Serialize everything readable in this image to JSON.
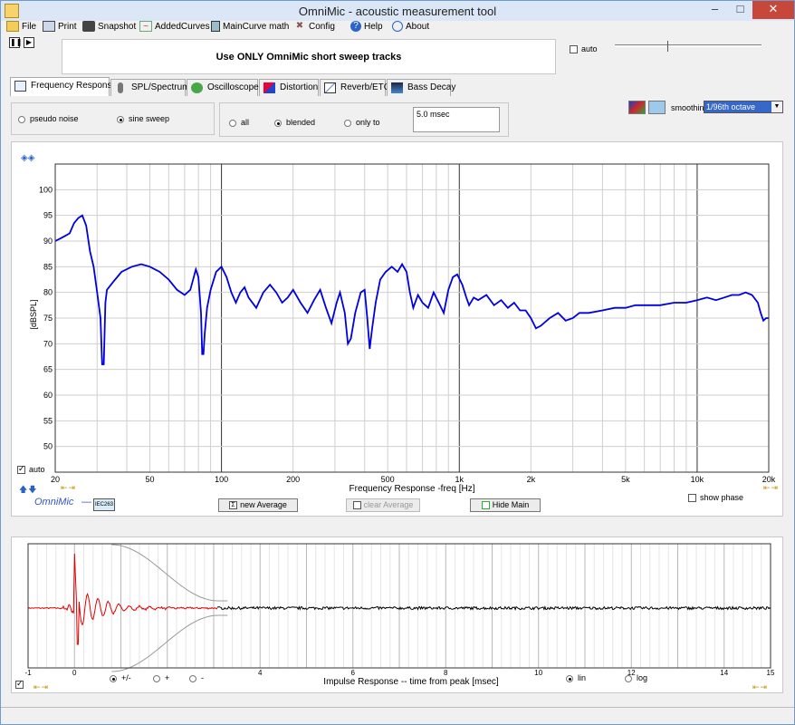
{
  "window": {
    "title": "OmniMic - acoustic measurement tool"
  },
  "menu": [
    {
      "label": "File",
      "icon": "folder-icon"
    },
    {
      "label": "Print",
      "icon": "printer-icon"
    },
    {
      "label": "Snapshot",
      "icon": "camera-icon"
    },
    {
      "label": "AddedCurves",
      "icon": "curves-icon"
    },
    {
      "label": "MainCurve math",
      "icon": "calculator-icon"
    },
    {
      "label": "Config",
      "icon": "tools-icon"
    },
    {
      "label": "Help",
      "icon": "help-icon"
    },
    {
      "label": "About",
      "icon": "chat-icon"
    }
  ],
  "banner": "Use ONLY OmniMic short sweep tracks",
  "top_auto_label": "auto",
  "tabs": [
    {
      "label": "Frequency Response",
      "active": true
    },
    {
      "label": "SPL/Spectrum"
    },
    {
      "label": "Oscilloscope"
    },
    {
      "label": "Distortion"
    },
    {
      "label": "Reverb/ETC"
    },
    {
      "label": "Bass Decay"
    }
  ],
  "mode": {
    "pseudo_noise": "pseudo noise",
    "sine_sweep": "sine sweep",
    "selected": "sine sweep"
  },
  "sync": {
    "all": "all",
    "blended": "blended",
    "only_to": "only to",
    "selected": "blended",
    "time_value": "5.0 msec"
  },
  "smoothing": {
    "label": "smoothing",
    "value": "1/96th octave"
  },
  "freq_controls": {
    "auto_label": "auto",
    "auto_checked": true,
    "brand": "OmniMic",
    "mic_badge": "IEC263",
    "new_average": "new Average",
    "clear_average": "clear Average",
    "hide_main": "Hide Main",
    "show_phase": "show phase"
  },
  "impulse_controls": {
    "pm": "+/-",
    "plus": "+",
    "minus": "-",
    "lin": "lin",
    "log": "log",
    "selected_polarity": "+/-",
    "selected_scale": "lin"
  },
  "chart_data": [
    {
      "type": "line",
      "xlabel": "Frequency Response -freq [Hz]",
      "ylabel": "[dBSPL]",
      "x_scale": "log",
      "xlim": [
        20,
        20000
      ],
      "ylim": [
        45,
        105
      ],
      "xticks": [
        {
          "value": 20,
          "label": "20"
        },
        {
          "value": 50,
          "label": "50"
        },
        {
          "value": 100,
          "label": "100"
        },
        {
          "value": 200,
          "label": "200"
        },
        {
          "value": 500,
          "label": "500"
        },
        {
          "value": 1000,
          "label": "1k"
        },
        {
          "value": 2000,
          "label": "2k"
        },
        {
          "value": 5000,
          "label": "5k"
        },
        {
          "value": 10000,
          "label": "10k"
        },
        {
          "value": 20000,
          "label": "20k"
        }
      ],
      "yticks": [
        50,
        55,
        60,
        65,
        70,
        75,
        80,
        85,
        90,
        95,
        100
      ],
      "grid": true,
      "series": [
        {
          "color": "#0000e0",
          "points": [
            [
              20,
              90
            ],
            [
              21,
              90.5
            ],
            [
              22,
              91
            ],
            [
              23,
              91.5
            ],
            [
              24,
              93.5
            ],
            [
              25,
              94.5
            ],
            [
              26,
              95
            ],
            [
              27,
              93
            ],
            [
              28,
              88
            ],
            [
              29,
              85
            ],
            [
              30,
              80
            ],
            [
              31,
              75
            ],
            [
              31.5,
              66
            ],
            [
              32,
              66
            ],
            [
              32.5,
              78
            ],
            [
              33,
              80.5
            ],
            [
              35,
              82
            ],
            [
              38,
              84
            ],
            [
              42,
              85
            ],
            [
              46,
              85.5
            ],
            [
              50,
              85
            ],
            [
              55,
              84
            ],
            [
              60,
              82.5
            ],
            [
              65,
              80.5
            ],
            [
              70,
              79.5
            ],
            [
              74,
              80.5
            ],
            [
              78,
              84.5
            ],
            [
              80,
              83
            ],
            [
              82,
              76
            ],
            [
              83,
              68
            ],
            [
              84,
              68
            ],
            [
              85,
              72
            ],
            [
              87,
              77
            ],
            [
              90,
              80.5
            ],
            [
              95,
              84
            ],
            [
              100,
              85
            ],
            [
              105,
              83
            ],
            [
              110,
              80
            ],
            [
              115,
              78
            ],
            [
              120,
              80
            ],
            [
              125,
              81
            ],
            [
              130,
              79
            ],
            [
              140,
              77
            ],
            [
              150,
              80
            ],
            [
              160,
              81.5
            ],
            [
              170,
              80
            ],
            [
              180,
              78
            ],
            [
              190,
              79
            ],
            [
              200,
              80.5
            ],
            [
              215,
              78
            ],
            [
              230,
              76
            ],
            [
              245,
              78.5
            ],
            [
              260,
              80.5
            ],
            [
              275,
              77
            ],
            [
              290,
              74
            ],
            [
              305,
              78
            ],
            [
              315,
              80
            ],
            [
              330,
              76
            ],
            [
              340,
              70
            ],
            [
              350,
              71
            ],
            [
              365,
              76
            ],
            [
              385,
              80
            ],
            [
              400,
              80.5
            ],
            [
              410,
              75
            ],
            [
              420,
              69
            ],
            [
              430,
              73
            ],
            [
              445,
              78
            ],
            [
              465,
              82.5
            ],
            [
              490,
              84
            ],
            [
              520,
              85
            ],
            [
              550,
              84
            ],
            [
              575,
              85.5
            ],
            [
              600,
              84
            ],
            [
              620,
              80
            ],
            [
              640,
              77
            ],
            [
              670,
              79.5
            ],
            [
              700,
              78
            ],
            [
              740,
              77
            ],
            [
              780,
              80
            ],
            [
              820,
              78
            ],
            [
              860,
              76
            ],
            [
              900,
              80.5
            ],
            [
              940,
              83
            ],
            [
              980,
              83.5
            ],
            [
              1030,
              81.5
            ],
            [
              1070,
              79
            ],
            [
              1100,
              77.5
            ],
            [
              1150,
              79
            ],
            [
              1200,
              78.5
            ],
            [
              1300,
              79.5
            ],
            [
              1400,
              77.5
            ],
            [
              1500,
              78.5
            ],
            [
              1600,
              77
            ],
            [
              1700,
              78
            ],
            [
              1800,
              76.5
            ],
            [
              1900,
              76.5
            ],
            [
              2000,
              75
            ],
            [
              2100,
              73
            ],
            [
              2200,
              73.5
            ],
            [
              2400,
              75
            ],
            [
              2600,
              76
            ],
            [
              2800,
              74.5
            ],
            [
              3000,
              75
            ],
            [
              3200,
              76
            ],
            [
              3500,
              76
            ],
            [
              4000,
              76.5
            ],
            [
              4500,
              77
            ],
            [
              5000,
              77
            ],
            [
              5500,
              77.5
            ],
            [
              6000,
              77.5
            ],
            [
              7000,
              77.5
            ],
            [
              8000,
              78
            ],
            [
              9000,
              78
            ],
            [
              10000,
              78.5
            ],
            [
              11000,
              79
            ],
            [
              12000,
              78.5
            ],
            [
              13000,
              79
            ],
            [
              14000,
              79.5
            ],
            [
              15000,
              79.5
            ],
            [
              16000,
              80
            ],
            [
              17000,
              79.5
            ],
            [
              18000,
              78
            ],
            [
              18500,
              76
            ],
            [
              19000,
              74.5
            ],
            [
              19500,
              75
            ],
            [
              20000,
              75
            ]
          ]
        }
      ]
    },
    {
      "type": "line",
      "xlabel": "Impulse Response  -- time from peak [msec]",
      "xlim": [
        -1,
        15
      ],
      "xticks": [
        {
          "value": -1,
          "label": "-1"
        },
        {
          "value": 0,
          "label": "0"
        },
        {
          "value": 4,
          "label": "4"
        },
        {
          "value": 6,
          "label": "6"
        },
        {
          "value": 8,
          "label": "8"
        },
        {
          "value": 10,
          "label": "10"
        },
        {
          "value": 12,
          "label": "12"
        },
        {
          "value": 14,
          "label": "14"
        },
        {
          "value": 15,
          "label": "15"
        }
      ],
      "window_end_ms": 3.1,
      "grid": true
    }
  ]
}
